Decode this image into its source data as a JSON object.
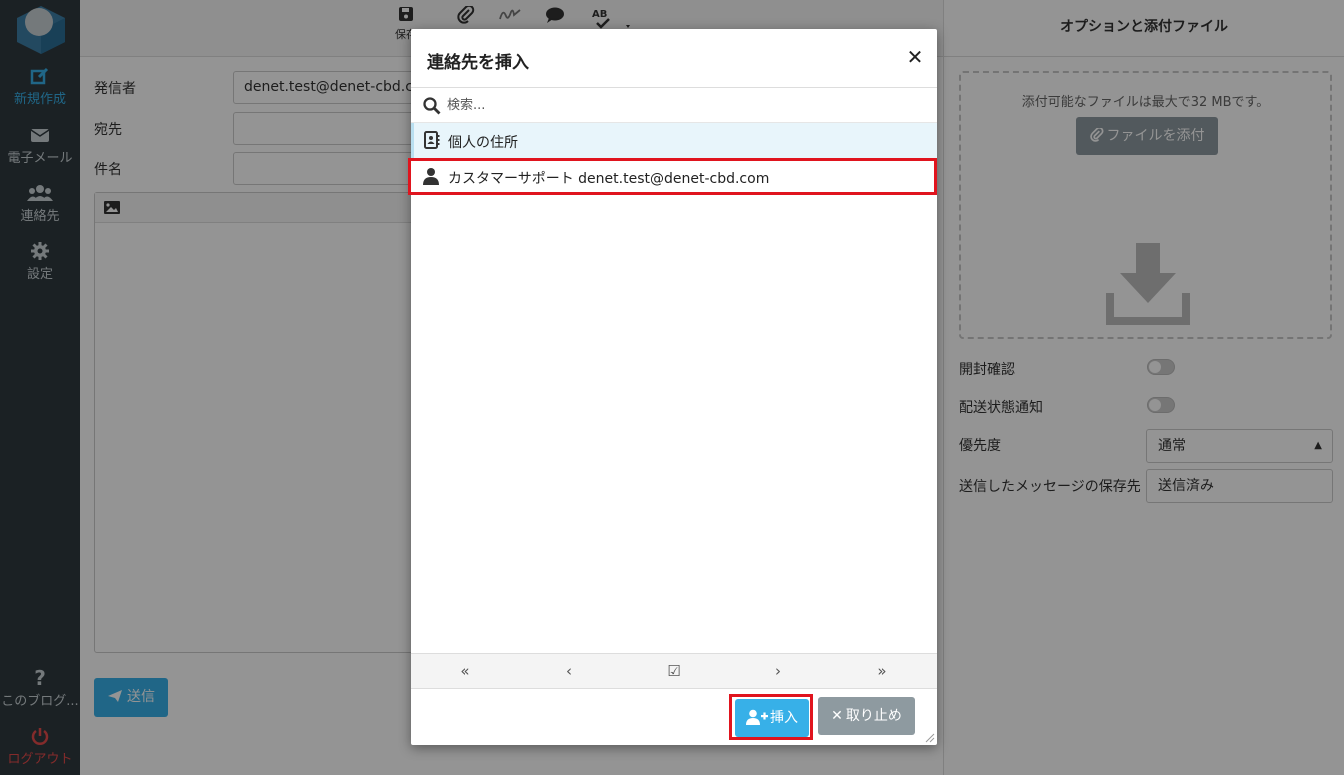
{
  "sidebar": {
    "items": [
      {
        "label": "新規作成",
        "icon": "compose-icon"
      },
      {
        "label": "電子メール",
        "icon": "envelope-icon"
      },
      {
        "label": "連絡先",
        "icon": "users-icon"
      },
      {
        "label": "設定",
        "icon": "gear-icon"
      }
    ],
    "bottom": [
      {
        "label": "このブログ...",
        "icon": "question-icon"
      },
      {
        "label": "ログアウト",
        "icon": "power-icon"
      }
    ]
  },
  "toolbar": {
    "save_label": "保存"
  },
  "compose": {
    "from_label": "発信者",
    "from_value": "denet.test@denet-cbd.com",
    "to_label": "宛先",
    "subject_label": "件名",
    "send_label": "送信"
  },
  "right_panel": {
    "title": "オプションと添付ファイル",
    "dropzone_text": "添付可能なファイルは最大で32 MBです。",
    "attach_label": "ファイルを添付",
    "read_receipt_label": "開封確認",
    "delivery_status_label": "配送状態通知",
    "priority_label": "優先度",
    "priority_value": "通常",
    "save_sent_label": "送信したメッセージの保存先",
    "save_sent_value": "送信済み"
  },
  "dialog": {
    "title": "連絡先を挿入",
    "search_placeholder": "検索...",
    "address_book": "個人の住所",
    "contact": "カスタマーサポート denet.test@denet-cbd.com",
    "pager": [
      "«",
      "‹",
      "☑",
      "›",
      "»"
    ],
    "insert_label": "挿入",
    "cancel_label": "取り止め"
  },
  "colors": {
    "accent": "#37b0e8",
    "sidebar_bg": "#2f3a3f",
    "highlight": "#e0141e",
    "secondary_button": "#8e9aa0"
  }
}
